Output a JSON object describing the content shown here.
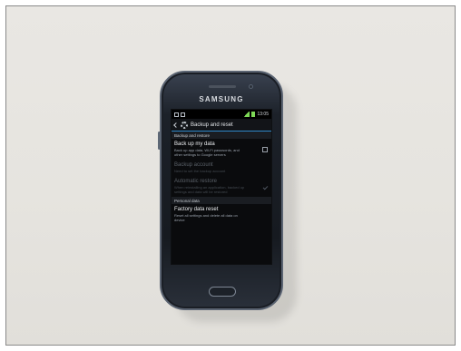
{
  "phone": {
    "brand": "SAMSUNG",
    "status_time": "13:05"
  },
  "screen": {
    "header_title": "Backup and reset",
    "section_backup": "Backup and restore",
    "items": [
      {
        "title": "Back up my data",
        "subtitle": "Back up app data, Wi-Fi passwords, and other settings to Google servers",
        "enabled": true,
        "control": "checkbox"
      },
      {
        "title": "Backup account",
        "subtitle": "Need to set the backup account",
        "enabled": false,
        "control": "none"
      },
      {
        "title": "Automatic restore",
        "subtitle": "When reinstalling an application, backed up settings and data will be restored",
        "enabled": false,
        "control": "check"
      }
    ],
    "section_personal": "Personal data",
    "factory_reset": {
      "title": "Factory data reset",
      "subtitle": "Reset all settings and delete all data on device"
    }
  },
  "colors": {
    "accent": "#2f88c9",
    "battery": "#7ed957",
    "background": "#e6e4df"
  }
}
